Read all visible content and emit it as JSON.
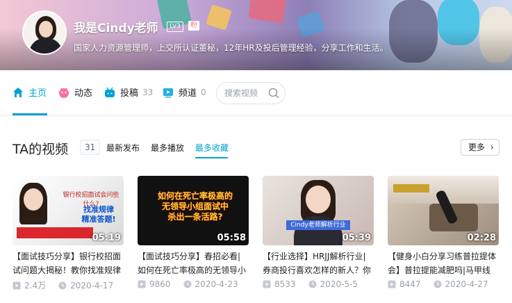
{
  "profile": {
    "name": "我是Cindy老师",
    "level": "LV3",
    "fan_badge": "粉",
    "sign": "国家人力资源管理师，上交所认证董秘，12年HR及投后管理经验，分享工作和生活。"
  },
  "nav": {
    "items": [
      {
        "label": "主页",
        "count": "",
        "icon": "home-icon"
      },
      {
        "label": "动态",
        "count": "",
        "icon": "dynamic-icon"
      },
      {
        "label": "投稿",
        "count": "33",
        "icon": "upload-icon"
      },
      {
        "label": "频道",
        "count": "0",
        "icon": "channel-icon"
      }
    ],
    "search_placeholder": "搜索视频"
  },
  "section": {
    "title": "TA的视频",
    "count": "31",
    "sort": [
      "最新发布",
      "最多播放",
      "最多收藏"
    ],
    "more": "更多"
  },
  "videos": [
    {
      "title_line1": "【面试技巧分享】银行校招面",
      "title_line2": "试问题大揭秘！教你找准规律",
      "plays": "2.4万",
      "date": "2020-4-17",
      "duration": "05:19",
      "thumb_text": [
        "找准规律",
        "精准答题!",
        "银行校招面试会问些什么?"
      ]
    },
    {
      "title_line1": "【面试技巧分享】春招必看|",
      "title_line2": "如何在死亡率极高的无领导小",
      "plays": "9860",
      "date": "2020-4-23",
      "duration": "05:58",
      "thumb_text": [
        "如何在死亡率极高的",
        "无领导小组面试中",
        "杀出一条活路?"
      ]
    },
    {
      "title_line1": "【行业选择】HRJJ解析行业|",
      "title_line2": "券商投行喜欢怎样的新人？你",
      "plays": "8533",
      "date": "2020-5-5",
      "duration": "05:39",
      "thumb_text": [
        "Cindy老师解析行业"
      ]
    },
    {
      "title_line1": "【健身小白分享习练普拉提体",
      "title_line2": "会】普拉提能减肥吗|马甲线",
      "plays": "8447",
      "date": "2020-4-27",
      "duration": "02:28",
      "thumb_text": []
    }
  ],
  "colors": {
    "accent": "#00a1d6",
    "pink": "#fb7299"
  }
}
